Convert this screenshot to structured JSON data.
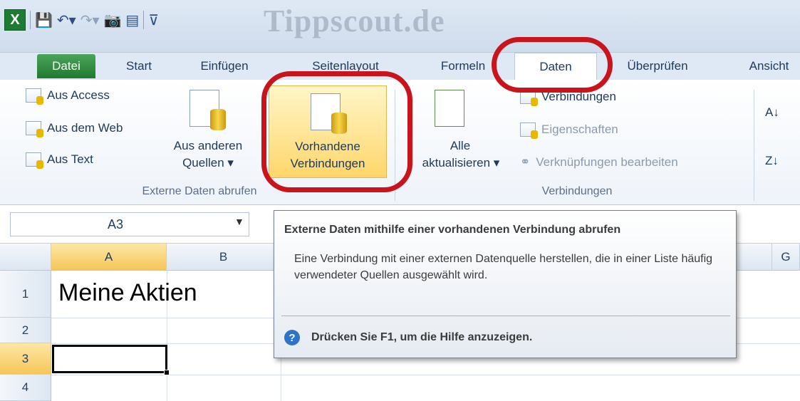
{
  "watermark": "Tippscout.de",
  "quick_access": {
    "logo": "X",
    "items": [
      "save-icon",
      "undo-icon",
      "redo-icon",
      "camera-icon",
      "form-icon",
      "customize-icon"
    ]
  },
  "tabs": [
    {
      "label": "Datei",
      "active": false
    },
    {
      "label": "Start",
      "active": false
    },
    {
      "label": "Einfügen",
      "active": false
    },
    {
      "label": "Seitenlayout",
      "active": false
    },
    {
      "label": "Formeln",
      "active": false
    },
    {
      "label": "Daten",
      "active": true
    },
    {
      "label": "Überprüfen",
      "active": false
    },
    {
      "label": "Ansicht",
      "active": false
    }
  ],
  "ribbon": {
    "external": {
      "aus_access": "Aus Access",
      "aus_web": "Aus dem Web",
      "aus_text": "Aus Text",
      "aus_anderen_1": "Aus anderen",
      "aus_anderen_2": "Quellen ▾",
      "vorhandene_1": "Vorhandene",
      "vorhandene_2": "Verbindungen",
      "group_label": "Externe Daten abrufen"
    },
    "connections": {
      "alle_1": "Alle",
      "alle_2": "aktualisieren ▾",
      "verbindungen": "Verbindungen",
      "eigenschaften": "Eigenschaften",
      "verknuepfungen": "Verknüpfungen bearbeiten",
      "group_label": "Verbindungen"
    },
    "sort": {
      "az": "A↓",
      "za": "Z↓"
    }
  },
  "formula_bar": {
    "name_box": "A3"
  },
  "grid": {
    "columns": [
      "A",
      "B",
      "G"
    ],
    "rows": [
      "1",
      "2",
      "3",
      "4"
    ],
    "active_column": "A",
    "active_row": "3",
    "cells": {
      "A1": "Meine Aktien"
    }
  },
  "tooltip": {
    "title": "Externe Daten mithilfe einer vorhandenen Verbindung abrufen",
    "body": "Eine Verbindung mit einer externen Datenquelle herstellen, die in einer Liste häufig verwendeter Quellen ausgewählt wird.",
    "help": "Drücken Sie F1, um die Hilfe anzuzeigen."
  },
  "colors": {
    "annotation": "#c8141a",
    "datei_tab": "#1f7a2f",
    "highlight": "#ffd66b"
  }
}
